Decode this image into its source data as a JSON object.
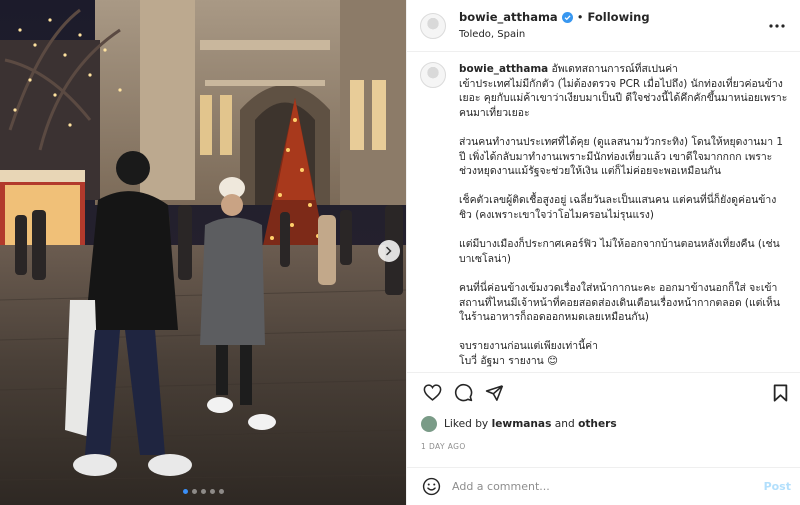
{
  "post": {
    "username": "bowie_atthama",
    "separator": "•",
    "follow_status": "Following",
    "location": "Toledo, Spain",
    "carousel": {
      "count": 5,
      "active_index": 0
    }
  },
  "caption": {
    "lines": [
      "อัพเดทสถานการณ์ที่สเปนค่า",
      "เข้าประเทศไม่มีกักตัว (ไม่ต้องตรวจ PCR เมื่อไปถึง) นักท่องเที่ยวค่อนข้างเยอะ คุยกับแม่ค้าเขาว่าเงียบมาเป็นปี ดีใจช่วงนี้ได้คึกคักขึ้นมาหน่อยเพราะคนมาเที่ยวเยอะ",
      "ส่วนคนทำงานประเทศที่ได้คุย (ดูแลสนามวัวกระทิง) โดนให้หยุดงานมา 1 ปี เพิ่งได้กลับมาทำงานเพราะมีนักท่องเที่ยวแล้ว เขาดีใจมากกกก เพราะช่วงหยุดงานแม้รัฐจะช่วยให้เงิน แต่ก็ไม่ค่อยจะพอเหมือนกัน",
      "เช็คตัวเลขผู้ติดเชื้อสูงอยู่ เฉลี่ยวันละเป็นแสนคน แต่คนที่นี่ก็ยังดูค่อนข้างชิว (คงเพราะเขาใจว่าโอไมครอนไม่รุนแรง)",
      "แต่มีบางเมืองก็ประกาศเคอร์ฟิว ไม่ให้ออกจากบ้านตอนหลังเที่ยงคืน (เช่นบาเซโลน่า)",
      "คนที่นี่ค่อนข้างเข้มงวดเรื่องใส่หน้ากากนะคะ ออกมาข้างนอกก็ใส่ จะเข้าสถานที่ไหนมีเจ้าหน้าที่คอยสอดส่องเดินเตือนเรื่องหน้ากากตลอด (แต่เห็นในร้านอาหารก็ถอดออกหมดเลยเหมือนกัน)",
      "จบรายงานก่อนแต่เพียงเท่านี้ค่า\nโบวี่ อัฐมา รายงาน 😊"
    ]
  },
  "likes": {
    "prefix": "Liked by",
    "user": "lewmanas",
    "joiner": "and",
    "others": "others"
  },
  "time_ago": "1 DAY AGO",
  "comment": {
    "placeholder": "Add a comment...",
    "post_label": "Post"
  },
  "colors": {
    "verified": "#3897f0",
    "accent": "#0095f6",
    "muted": "#8e8e8e",
    "border": "#efefef"
  },
  "icons": [
    "verified-badge-icon",
    "more-options-icon",
    "heart-icon",
    "comment-icon",
    "share-icon",
    "bookmark-icon",
    "emoji-icon",
    "chevron-right-icon"
  ]
}
